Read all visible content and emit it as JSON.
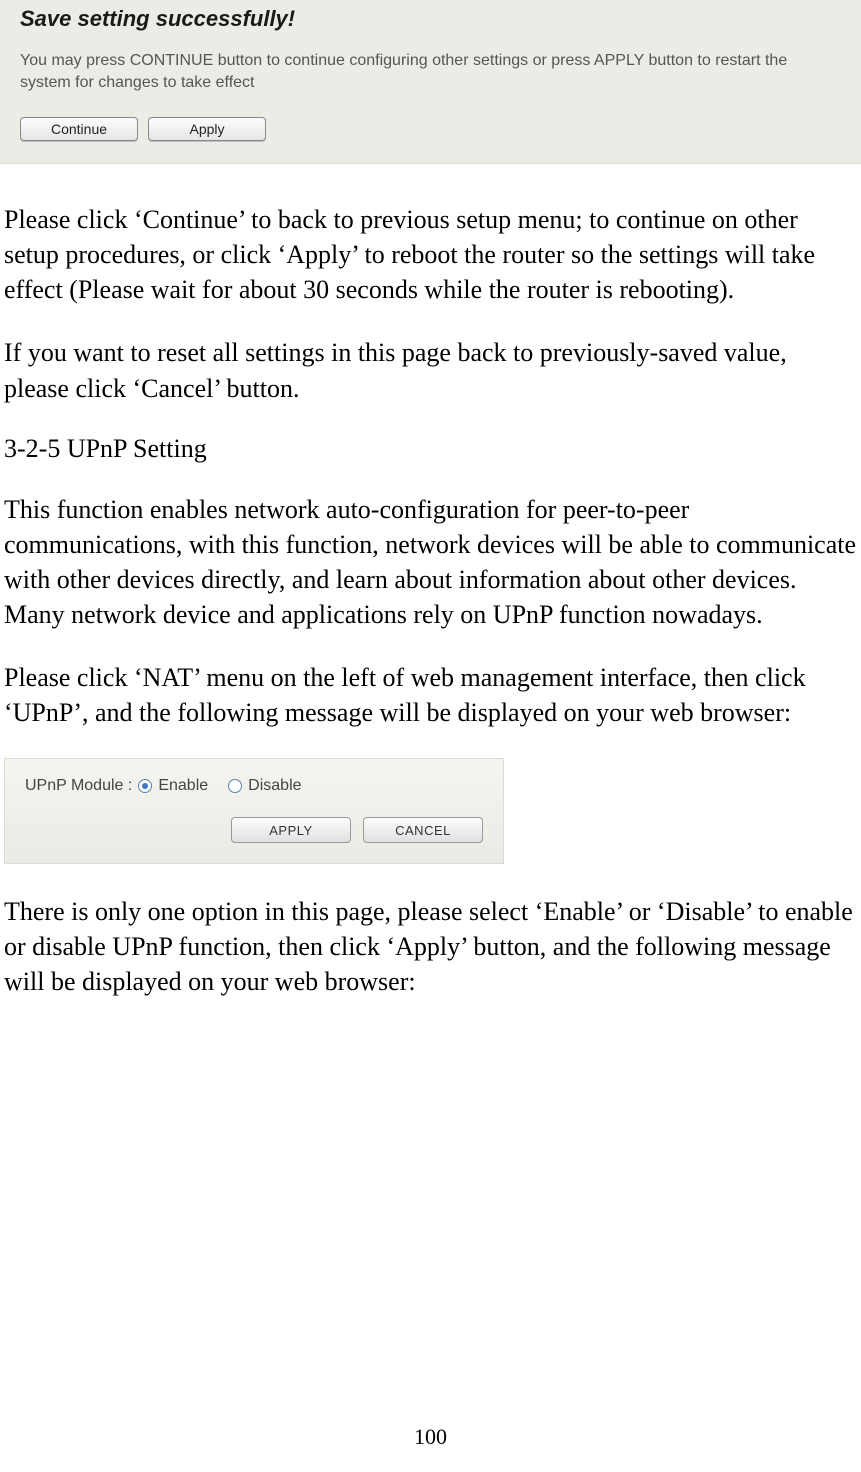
{
  "panel1": {
    "title": "Save setting successfully!",
    "desc": "You may press CONTINUE button to continue configuring other settings or press APPLY button to restart the system for changes to take effect",
    "continue_label": "Continue",
    "apply_label": "Apply"
  },
  "doc": {
    "p1": "Please click ‘Continue’ to back to previous setup menu; to continue on other setup procedures, or click ‘Apply’ to reboot the router so the settings will take effect (Please wait for about 30 seconds while the router is rebooting).",
    "p2": "If you want to reset all settings in this page back to previously-saved value, please click ‘Cancel’ button.",
    "section_title": "3-2-5 UPnP Setting",
    "p3": "This function enables network auto-configuration for peer-to-peer communications, with this function, network devices will be able to communicate with other devices directly, and learn about information about other devices. Many network device and applications rely on UPnP function nowadays.",
    "p4": "Please click ‘NAT’ menu on the left of web management interface, then click ‘UPnP’, and the following message will be displayed on your web browser:",
    "p5": "There is only one option in this page, please select ‘Enable’ or ‘Disable’ to enable or disable UPnP function, then click ‘Apply’ button, and the following message will be displayed on your web browser:",
    "page_number": "100"
  },
  "upnp": {
    "label": "UPnP Module :",
    "enable": "Enable",
    "disable": "Disable",
    "selected": "Enable",
    "apply": "APPLY",
    "cancel": "CANCEL"
  }
}
